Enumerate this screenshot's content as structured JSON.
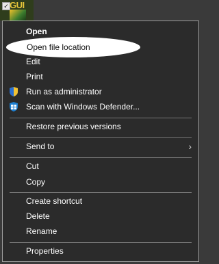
{
  "file_icon": {
    "label": "GUI"
  },
  "menu": {
    "items": [
      {
        "label": "Open"
      },
      {
        "label": "Open file location"
      },
      {
        "label": "Edit"
      },
      {
        "label": "Print"
      },
      {
        "label": "Run as administrator",
        "icon": "uac-shield-icon"
      },
      {
        "label": "Scan with Windows Defender...",
        "icon": "windows-defender-icon"
      },
      {
        "label": "Restore previous versions"
      },
      {
        "label": "Send to",
        "has_submenu": true
      },
      {
        "label": "Cut"
      },
      {
        "label": "Copy"
      },
      {
        "label": "Create shortcut"
      },
      {
        "label": "Delete"
      },
      {
        "label": "Rename"
      },
      {
        "label": "Properties"
      }
    ],
    "highlighted_item": "Open file location"
  },
  "colors": {
    "menu_bg": "#2b2b2b",
    "menu_text": "#ffffff",
    "highlight": "#ffffff",
    "desktop_bg": "#3a3a3a"
  }
}
